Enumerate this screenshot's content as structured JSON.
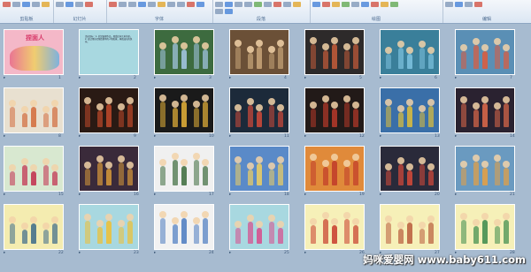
{
  "ribbon": {
    "groups": [
      {
        "label": "剪贴板",
        "colors": [
          "c1",
          "",
          "c2",
          "",
          "c3"
        ]
      },
      {
        "label": "幻灯片",
        "colors": [
          "",
          "c2",
          "",
          "c1"
        ]
      },
      {
        "label": "字体",
        "colors": [
          "c1",
          "",
          "",
          "c2",
          "",
          "c3",
          "",
          "",
          "c1",
          "c2"
        ]
      },
      {
        "label": "段落",
        "colors": [
          "",
          "c2",
          "",
          "",
          "c4",
          "",
          "c1",
          "",
          "c3",
          "",
          "c2"
        ]
      },
      {
        "label": "绘图",
        "colors": [
          "c2",
          "c1",
          "c3",
          "c4",
          "",
          "c2",
          "c1",
          "c3",
          "c4"
        ]
      },
      {
        "label": "编辑",
        "colors": [
          "",
          "c2",
          "",
          "c1"
        ]
      }
    ]
  },
  "slides": [
    {
      "num": "1",
      "kind": "title",
      "title": "捏面人",
      "bg": "#f4b8c8"
    },
    {
      "num": "2",
      "kind": "text",
      "bg": "#a8d8e0",
      "text": "活动目标：1. 欣赏面塑作品，感受民间艺术的美。 2. 尝试用彩泥塑造简单的人物形象，体验成功的快乐。"
    },
    {
      "num": "3",
      "kind": "photo",
      "bg": "#3d6b3f",
      "accent": "#a7c9e8"
    },
    {
      "num": "4",
      "kind": "photo",
      "bg": "#6b5037",
      "accent": "#c9a67a"
    },
    {
      "num": "5",
      "kind": "photo",
      "bg": "#2d2a2a",
      "accent": "#c75d3a"
    },
    {
      "num": "6",
      "kind": "photo",
      "bg": "#3a7f9a",
      "accent": "#7fc3e0"
    },
    {
      "num": "7",
      "kind": "photo",
      "bg": "#5a8fb5",
      "accent": "#e05a3a"
    },
    {
      "num": "8",
      "kind": "photo",
      "bg": "#e8e0d0",
      "accent": "#d26a3a"
    },
    {
      "num": "9",
      "kind": "photo",
      "bg": "#2a1a14",
      "accent": "#c14a2a"
    },
    {
      "num": "10",
      "kind": "photo",
      "bg": "#1a1a1a",
      "accent": "#e8b43a"
    },
    {
      "num": "11",
      "kind": "photo",
      "bg": "#1c2a3a",
      "accent": "#d24a3a"
    },
    {
      "num": "12",
      "kind": "photo",
      "bg": "#221a18",
      "accent": "#b83a2a"
    },
    {
      "num": "13",
      "kind": "photo",
      "bg": "#3a6fa8",
      "accent": "#e0c03a"
    },
    {
      "num": "14",
      "kind": "photo",
      "bg": "#2a2230",
      "accent": "#e06a4a"
    },
    {
      "num": "15",
      "kind": "photo",
      "bg": "#d8e8d0",
      "accent": "#c22a4a"
    },
    {
      "num": "16",
      "kind": "photo",
      "bg": "#3a2a3a",
      "accent": "#d89a3a"
    },
    {
      "num": "17",
      "kind": "photo",
      "bg": "#f0f0f0",
      "accent": "#3a6a3a"
    },
    {
      "num": "18",
      "kind": "photo",
      "bg": "#5a8ac8",
      "accent": "#f0d060"
    },
    {
      "num": "19",
      "kind": "photo",
      "bg": "#e08a3a",
      "accent": "#c03a2a"
    },
    {
      "num": "20",
      "kind": "photo",
      "bg": "#2a2a3a",
      "accent": "#d84a3a"
    },
    {
      "num": "21",
      "kind": "photo",
      "bg": "#6a9ac0",
      "accent": "#e8a040"
    },
    {
      "num": "22",
      "kind": "photo",
      "bg": "#f4ecb0",
      "accent": "#3a6a8a"
    },
    {
      "num": "23",
      "kind": "photo",
      "bg": "#a8d8e0",
      "accent": "#f0c030"
    },
    {
      "num": "24",
      "kind": "photo",
      "bg": "#f2f2f2",
      "accent": "#4a7ac0"
    },
    {
      "num": "25",
      "kind": "photo",
      "bg": "#a8d8e0",
      "accent": "#d84a8a"
    },
    {
      "num": "26",
      "kind": "photo",
      "bg": "#f6f0b8",
      "accent": "#c83a2a"
    },
    {
      "num": "27",
      "kind": "photo",
      "bg": "#f6f0b8",
      "accent": "#b85a3a"
    },
    {
      "num": "28",
      "kind": "photo",
      "bg": "#f6f0b8",
      "accent": "#3a8a4a"
    }
  ],
  "watermark": "妈咪爱婴网 www.baby611.com"
}
